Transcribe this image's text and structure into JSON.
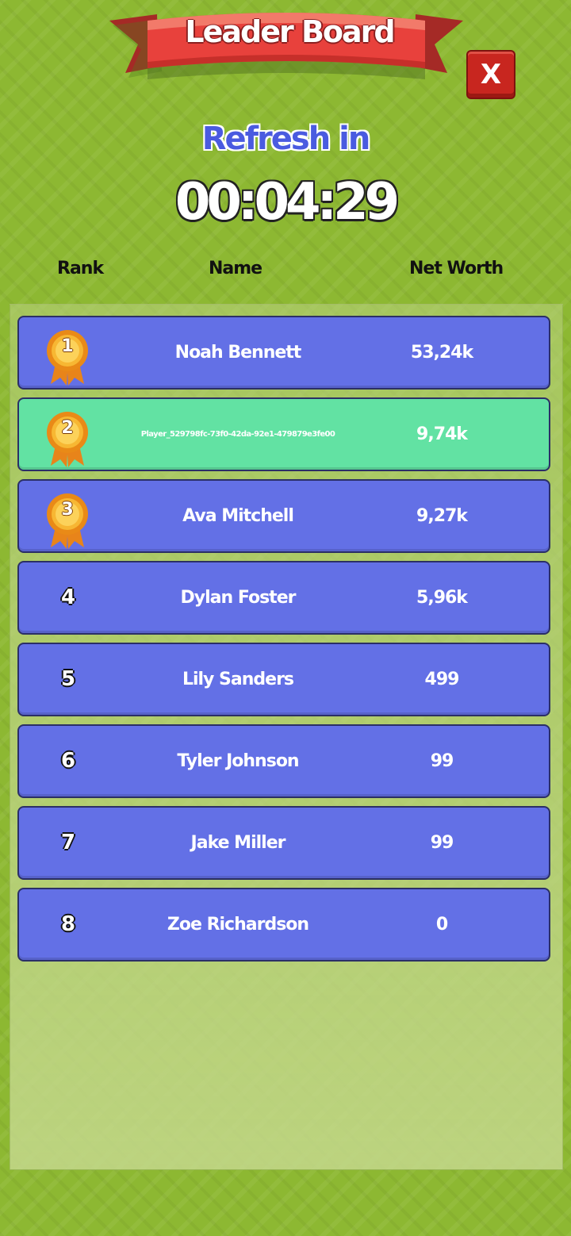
{
  "header": {
    "title": "Leader Board",
    "close_label": "X"
  },
  "refresh": {
    "label": "Refresh in",
    "timer": "00:04:29"
  },
  "columns": {
    "rank": "Rank",
    "name": "Name",
    "net_worth": "Net Worth"
  },
  "colors": {
    "background": "#8db832",
    "row": "#6370e6",
    "row_current_player": "#62e2a3",
    "ribbon": "#e8413c",
    "close_button": "#c8261f",
    "medal": "#f5a623"
  },
  "rows": [
    {
      "rank": "1",
      "name": "Noah Bennett",
      "net_worth": "53,24k",
      "medal": "medal-icon"
    },
    {
      "rank": "2",
      "name": "Player_529798fc-73f0-42da-92e1-479879e3fe00",
      "net_worth": "9,74k",
      "medal": "medal-icon",
      "current_player": true
    },
    {
      "rank": "3",
      "name": "Ava Mitchell",
      "net_worth": "9,27k",
      "medal": "medal-icon"
    },
    {
      "rank": "4",
      "name": "Dylan Foster",
      "net_worth": "5,96k"
    },
    {
      "rank": "5",
      "name": "Lily Sanders",
      "net_worth": "499"
    },
    {
      "rank": "6",
      "name": "Tyler Johnson",
      "net_worth": "99"
    },
    {
      "rank": "7",
      "name": "Jake Miller",
      "net_worth": "99"
    },
    {
      "rank": "8",
      "name": "Zoe Richardson",
      "net_worth": "0"
    }
  ]
}
